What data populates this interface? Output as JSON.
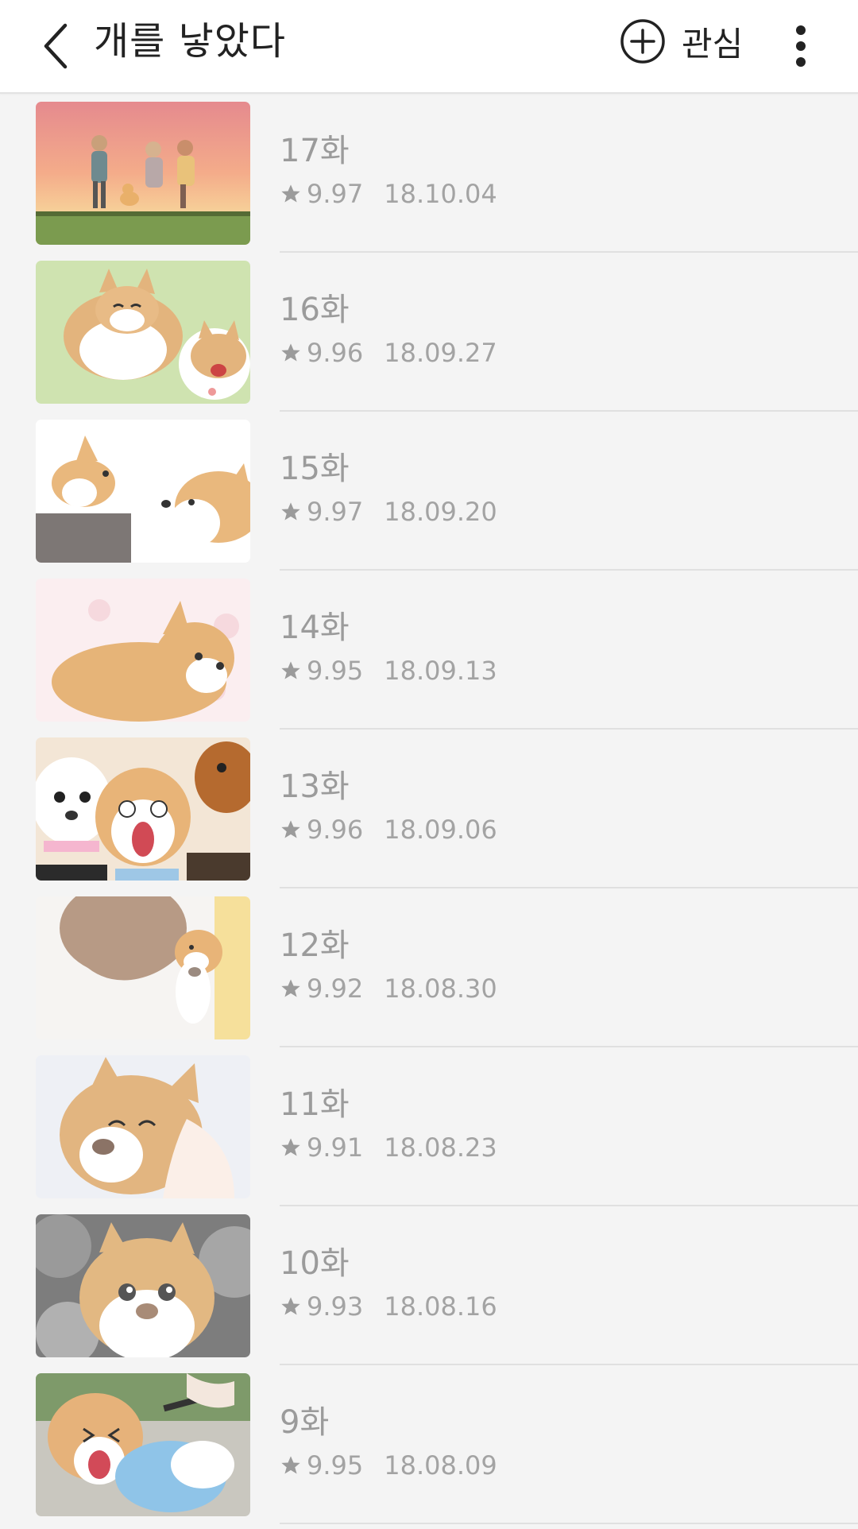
{
  "header": {
    "title": "개를 낳았다",
    "favorite_label": "관심"
  },
  "colors": {
    "text_primary": "#222222",
    "text_muted": "#9b9b9b",
    "background": "#f4f4f4",
    "header_bg": "#ffffff"
  },
  "episodes": [
    {
      "title": "17화",
      "rating": "9.97",
      "date": "18.10.04",
      "thumbnail": "sunset-family-walking-dog"
    },
    {
      "title": "16화",
      "rating": "9.96",
      "date": "18.09.27",
      "thumbnail": "two-shiba-dogs-playing"
    },
    {
      "title": "15화",
      "rating": "9.97",
      "date": "18.09.20",
      "thumbnail": "puppy-and-dog-facing"
    },
    {
      "title": "14화",
      "rating": "9.95",
      "date": "18.09.13",
      "thumbnail": "shiba-with-blossoms"
    },
    {
      "title": "13화",
      "rating": "9.96",
      "date": "18.09.06",
      "thumbnail": "surprised-dog-crowd"
    },
    {
      "title": "12화",
      "rating": "9.92",
      "date": "18.08.30",
      "thumbnail": "puppy-hugged"
    },
    {
      "title": "11화",
      "rating": "9.91",
      "date": "18.08.23",
      "thumbnail": "happy-dog-petted"
    },
    {
      "title": "10화",
      "rating": "9.93",
      "date": "18.08.16",
      "thumbnail": "fluffy-dog-smoke"
    },
    {
      "title": "9화",
      "rating": "9.95",
      "date": "18.08.09",
      "thumbnail": "dog-crying-on-leash"
    }
  ]
}
